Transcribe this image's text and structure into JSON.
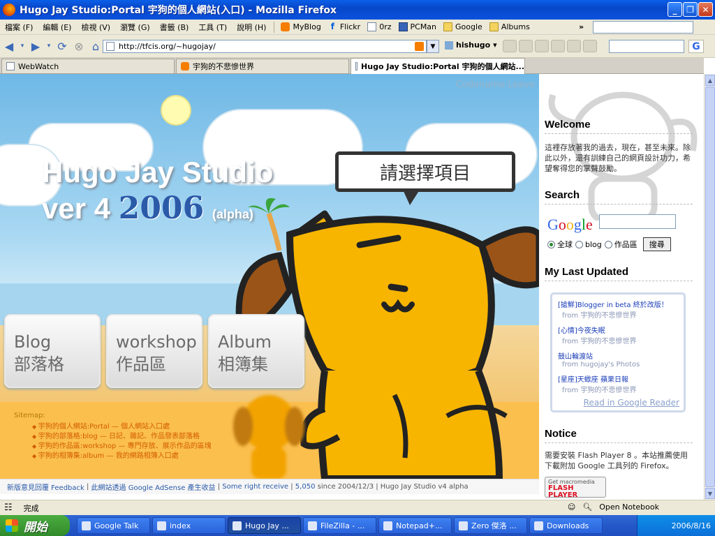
{
  "window": {
    "title": "Hugo Jay Studio:Portal 宇狗的個人網站(入口) - Mozilla Firefox"
  },
  "menu": [
    "檔案 (F)",
    "編輯 (E)",
    "檢視 (V)",
    "瀏覽 (G)",
    "書籤 (B)",
    "工具 (T)",
    "說明 (H)"
  ],
  "bookmarks": [
    {
      "label": "MyBlog",
      "icon": "blogger-icon"
    },
    {
      "label": "Flickr",
      "icon": "flickr-icon"
    },
    {
      "label": "0rz",
      "icon": "page-icon"
    },
    {
      "label": "PCMan",
      "icon": "pcman-icon"
    },
    {
      "label": "Google",
      "icon": "folder-icon"
    },
    {
      "label": "Albums",
      "icon": "folder-icon"
    }
  ],
  "bookmarks_overflow": "»",
  "address": {
    "url": "http://tfcis.org/~hugojay/"
  },
  "toolbar": {
    "hishugo": "hishugo"
  },
  "tabs": [
    {
      "label": "WebWatch"
    },
    {
      "label": "宇狗的不悲慘世界"
    },
    {
      "label": "Hugo Jay Studio:Portal 宇狗的個人網站..."
    }
  ],
  "flash": {
    "codename": "Codename:Leave",
    "title_line1": "Hugo Jay Studio",
    "title_ver": "ver 4",
    "year": "2006",
    "alpha": "(alpha)",
    "bubble": "請選擇項目",
    "buttons": [
      {
        "en": "Blog",
        "zh": "部落格"
      },
      {
        "en": "workshop",
        "zh": "作品區"
      },
      {
        "en": "Album",
        "zh": "相簿集"
      }
    ],
    "sitemap_label": "Sitemap:",
    "sitemap": [
      "宇狗的個人網站:Portal — 個人網站入口處",
      "宇狗的部落格:blog — 日記、雜記、作品發表部落格",
      "宇狗的作品區:workshop — 專門存放、展示作品的區塊",
      "宇狗的相簿集:album — 我的網路相簿入口處"
    ]
  },
  "footer": {
    "link1": "新版意見回覆 Feedback",
    "link2": "此網站透過 Google AdSense 產生收益",
    "link3": "Some right receive",
    "link4": "5,050",
    "rest": "since 2004/12/3 | Hugo Jay Studio v4 alpha"
  },
  "sidebar": {
    "welcome_title": "Welcome",
    "welcome_text": "這裡存放著我的過去，現在，甚至未來。除此以外，還有訓練自己的網頁設計功力，希望奪得您的掌聲鼓勵。",
    "search_title": "Search",
    "google_logo": [
      "G",
      "o",
      "o",
      "g",
      "l",
      "e"
    ],
    "radios": [
      "全球",
      "blog",
      "作品區"
    ],
    "search_button": "搜尋",
    "last_updated_title": "My Last Updated",
    "feed": [
      {
        "title": "[搶鮮]Blogger in beta 終於改版！",
        "source": "from 宇狗的不悲慘世界"
      },
      {
        "title": "[心情]今夜失眠",
        "source": "from 宇狗的不悲慘世界"
      },
      {
        "title": "鼓山輪渡站",
        "source": "from hugojay's Photos"
      },
      {
        "title": "[星座]天蠍座 蘋果日報",
        "source": "from 宇狗的不悲慘世界"
      }
    ],
    "read_link": "Read in Google Reader",
    "notice_title": "Notice",
    "notice_text": "需要安裝 Flash Player 8 。本站推薦使用 下載附加 Google 工具列的 Firefox。",
    "flash_badge_top": "Get macromedia",
    "flash_badge_main": "FLASH",
    "flash_badge_bottom": "PLAYER"
  },
  "status": {
    "text": "完成",
    "notebook": "Open Notebook"
  },
  "taskbar": {
    "start": "開始",
    "items": [
      {
        "label": "Google Talk",
        "active": false
      },
      {
        "label": "index",
        "active": false
      },
      {
        "label": "Hugo Jay ...",
        "active": true
      },
      {
        "label": "FileZilla - ...",
        "active": false
      },
      {
        "label": "Notepad+...",
        "active": false
      },
      {
        "label": "Zero 傑洛 ...",
        "active": false
      },
      {
        "label": "Downloads",
        "active": false
      }
    ],
    "clock": "2006/8/16"
  }
}
